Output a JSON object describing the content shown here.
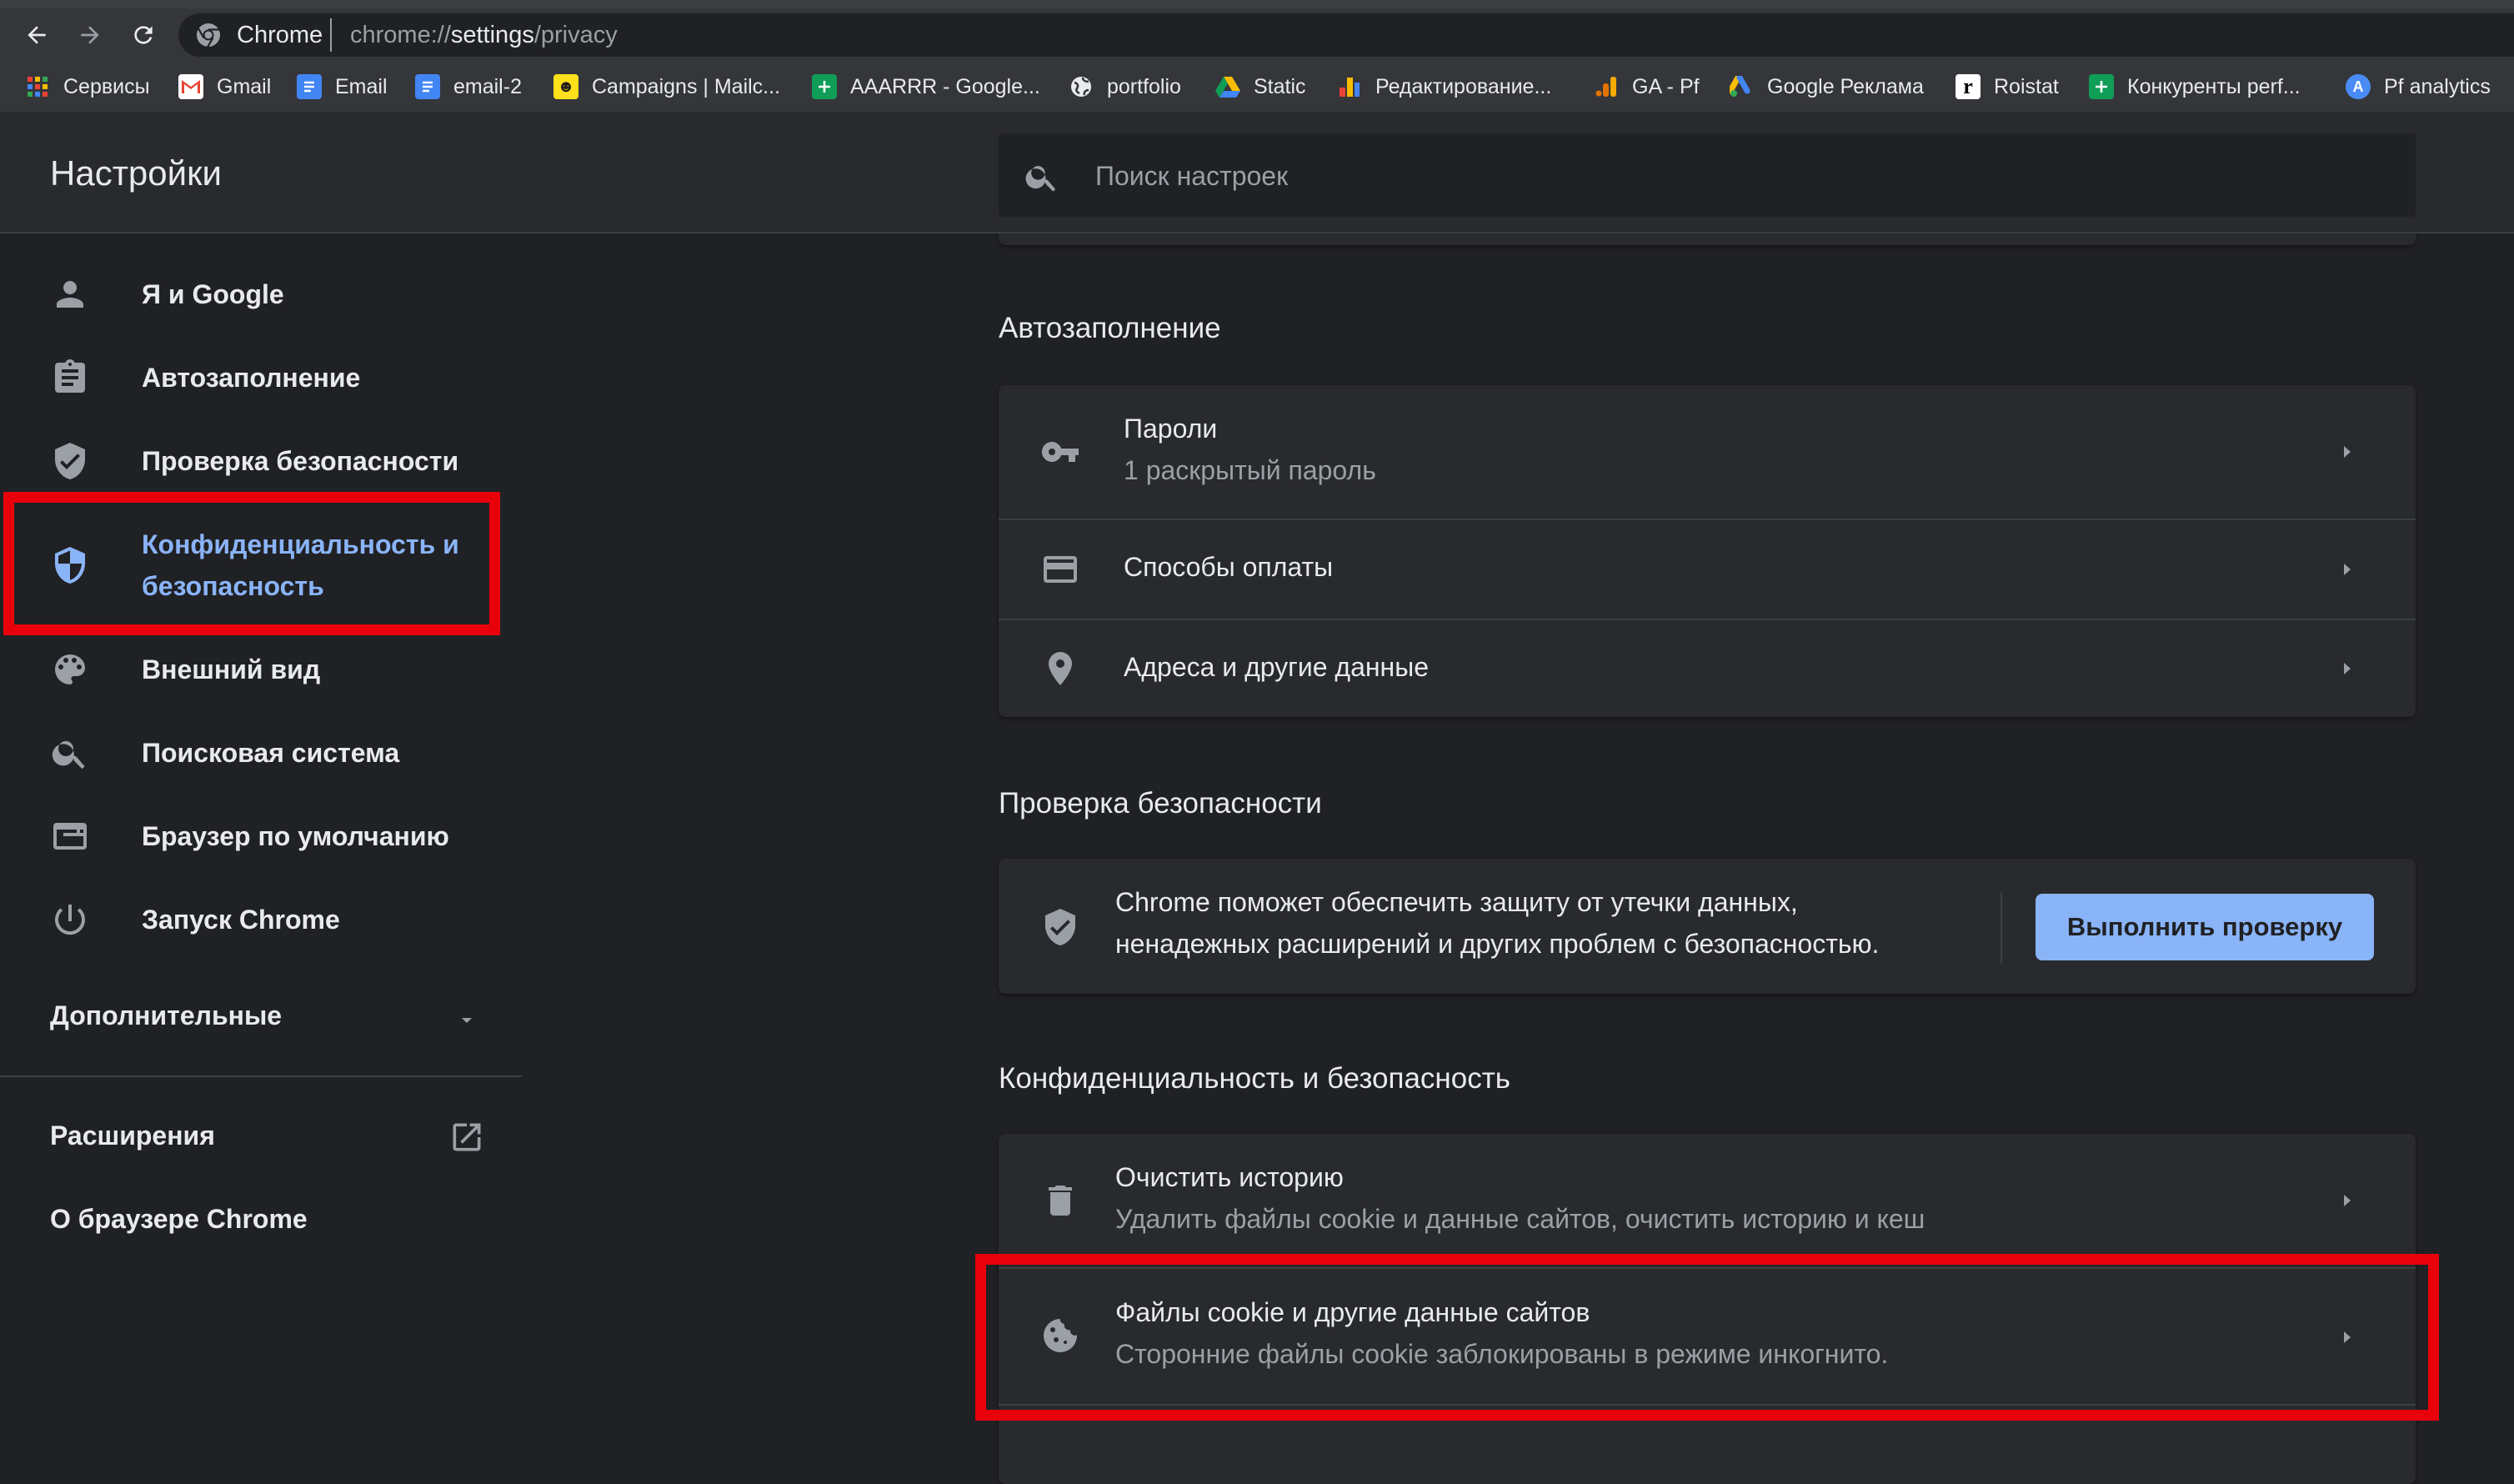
{
  "browser": {
    "site_name": "Chrome",
    "url_scheme": "chrome://",
    "url_host": "settings",
    "url_path": "/privacy"
  },
  "bookmarks": [
    {
      "label": "Сервисы",
      "icon": "apps-grid-icon"
    },
    {
      "label": "Gmail",
      "icon": "gmail-icon"
    },
    {
      "label": "Email",
      "icon": "docs-icon"
    },
    {
      "label": "email-2",
      "icon": "docs-icon"
    },
    {
      "label": "Campaigns | Mailc...",
      "icon": "mailchimp-icon"
    },
    {
      "label": "AAARRR - Google...",
      "icon": "sheets-icon"
    },
    {
      "label": "portfolio",
      "icon": "globe-icon"
    },
    {
      "label": "Static",
      "icon": "drive-icon"
    },
    {
      "label": "Редактирование...",
      "icon": "analytics-bars-icon"
    },
    {
      "label": "GA - Pf",
      "icon": "analytics-icon"
    },
    {
      "label": "Google Реклама",
      "icon": "google-ads-icon"
    },
    {
      "label": "Roistat",
      "icon": "roistat-icon"
    },
    {
      "label": "Конкуренты perf...",
      "icon": "sheets-icon"
    },
    {
      "label": "Pf analytics",
      "icon": "appstore-icon"
    }
  ],
  "header": {
    "title": "Настройки",
    "search_placeholder": "Поиск настроек"
  },
  "sidebar": {
    "items": [
      {
        "label": "Я и Google",
        "icon": "person-icon"
      },
      {
        "label": "Автозаполнение",
        "icon": "clipboard-icon"
      },
      {
        "label": "Проверка безопасности",
        "icon": "shield-check-icon"
      },
      {
        "label": "Конфиденциальность и безопасность",
        "icon": "shield-privacy-icon",
        "active": true
      },
      {
        "label": "Внешний вид",
        "icon": "palette-icon"
      },
      {
        "label": "Поисковая система",
        "icon": "search-icon"
      },
      {
        "label": "Браузер по умолчанию",
        "icon": "browser-window-icon"
      },
      {
        "label": "Запуск Chrome",
        "icon": "power-icon"
      }
    ],
    "advanced_label": "Дополнительные",
    "extensions_label": "Расширения",
    "about_label": "О браузере Chrome"
  },
  "autofill": {
    "title": "Автозаполнение",
    "rows": [
      {
        "label": "Пароли",
        "sublabel": "1 раскрытый пароль",
        "icon": "key-icon"
      },
      {
        "label": "Способы оплаты",
        "icon": "credit-card-icon"
      },
      {
        "label": "Адреса и другие данные",
        "icon": "location-pin-icon"
      }
    ]
  },
  "safety_check": {
    "title": "Проверка безопасности",
    "text_line1": "Chrome поможет обеспечить защиту от утечки данных,",
    "text_line2": "ненадежных расширений и других проблем с безопасностью.",
    "button_label": "Выполнить проверку"
  },
  "privacy": {
    "title": "Конфиденциальность и безопасность",
    "rows": [
      {
        "label": "Очистить историю",
        "sublabel": "Удалить файлы cookie и данные сайтов, очистить историю и кеш",
        "icon": "trash-icon"
      },
      {
        "label": "Файлы cookie и другие данные сайтов",
        "sublabel": "Сторонние файлы cookie заблокированы в режиме инкогнито.",
        "icon": "cookie-icon"
      }
    ]
  },
  "colors": {
    "background": "#202124",
    "card": "#292a2d",
    "accent": "#8ab4f8",
    "highlight_box": "#e8000b"
  }
}
